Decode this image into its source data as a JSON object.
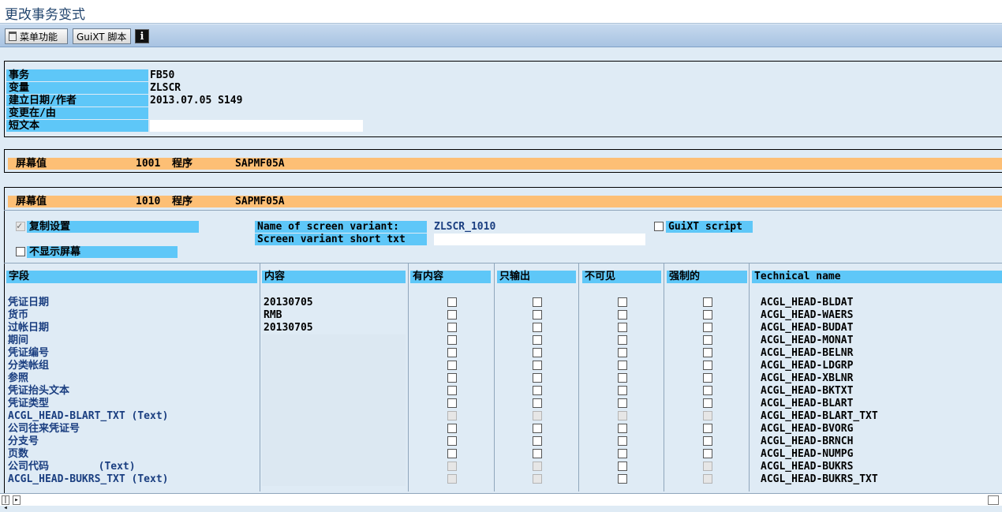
{
  "window": {
    "title": "更改事务变式"
  },
  "toolbar": {
    "menu_label": "菜单功能",
    "guixt_label": "GuiXT 脚本",
    "info_label": "i"
  },
  "header": {
    "labels": [
      "事务",
      "变量",
      "建立日期/作者",
      "变更在/由",
      "短文本"
    ],
    "values": [
      "FB50",
      "ZLSCR",
      "2013.07.05 S149",
      "",
      ""
    ]
  },
  "screen1": {
    "label": "屏幕值",
    "number": "1001",
    "program_label": "程序",
    "program": "SAPMF05A"
  },
  "screen2": {
    "label": "屏幕值",
    "number": "1010",
    "program_label": "程序",
    "program": "SAPMF05A"
  },
  "options": {
    "copy_settings": "复制设置",
    "copy_checked": true,
    "hide_screen": "不显示屏幕",
    "hide_checked": false,
    "name_label": "Name of screen variant:",
    "name_value": "ZLSCR_1010",
    "short_label": "Screen variant short txt",
    "short_value": "",
    "guixt_label": "GuiXT script",
    "guixt_checked": false
  },
  "table": {
    "headers": [
      "字段",
      "内容",
      "有内容",
      "只输出",
      "不可见",
      "强制的",
      "Technical name"
    ],
    "rows": [
      {
        "field": "凭证日期",
        "content": "20130705",
        "tech": "ACGL_HEAD-BLDAT",
        "dis": false
      },
      {
        "field": "货币",
        "content": "RMB",
        "tech": "ACGL_HEAD-WAERS",
        "dis": false
      },
      {
        "field": "过帐日期",
        "content": "20130705",
        "tech": "ACGL_HEAD-BUDAT",
        "dis": false
      },
      {
        "field": "期间",
        "content": "",
        "tech": "ACGL_HEAD-MONAT",
        "dis": false
      },
      {
        "field": "凭证编号",
        "content": "",
        "tech": "ACGL_HEAD-BELNR",
        "dis": false
      },
      {
        "field": "分类帐组",
        "content": "",
        "tech": "ACGL_HEAD-LDGRP",
        "dis": false
      },
      {
        "field": "参照",
        "content": "",
        "tech": "ACGL_HEAD-XBLNR",
        "dis": false
      },
      {
        "field": "凭证抬头文本",
        "content": "",
        "tech": "ACGL_HEAD-BKTXT",
        "dis": false
      },
      {
        "field": "凭证类型",
        "content": "",
        "tech": "ACGL_HEAD-BLART",
        "dis": false
      },
      {
        "field": "ACGL_HEAD-BLART_TXT (Text)",
        "content": "",
        "tech": "ACGL_HEAD-BLART_TXT",
        "dis": true
      },
      {
        "field": "公司往来凭证号",
        "content": "",
        "tech": "ACGL_HEAD-BVORG",
        "dis": false
      },
      {
        "field": "分支号",
        "content": "",
        "tech": "ACGL_HEAD-BRNCH",
        "dis": false
      },
      {
        "field": "页数",
        "content": "",
        "tech": "ACGL_HEAD-NUMPG",
        "dis": false
      },
      {
        "field": "公司代码        (Text)",
        "content": "",
        "tech": "ACGL_HEAD-BUKRS",
        "dis": "partial"
      },
      {
        "field": "ACGL_HEAD-BUKRS_TXT (Text)",
        "content": "",
        "tech": "ACGL_HEAD-BUKRS_TXT",
        "dis": "partial"
      }
    ]
  }
}
